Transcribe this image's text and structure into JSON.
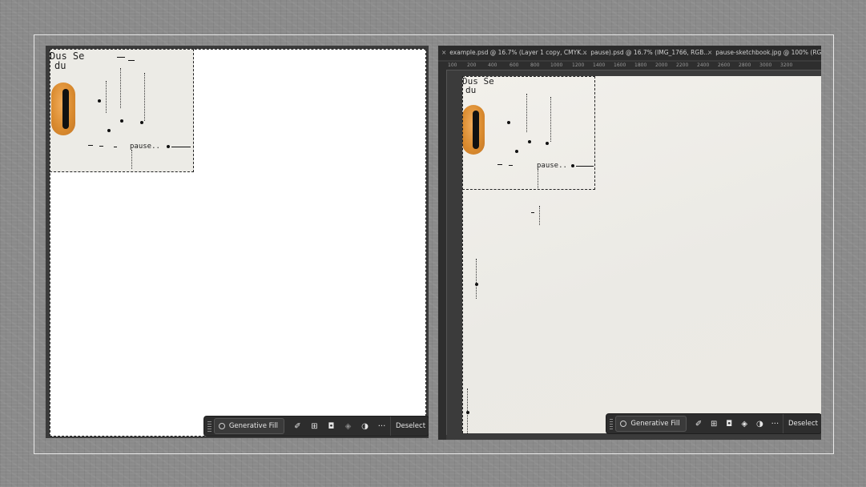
{
  "left_panel": {
    "art": {
      "handwriting_lines": [
        "Dus Se",
        "du"
      ],
      "label": "pause.."
    },
    "taskbar": {
      "generative_fill_label": "Generative Fill",
      "deselect_label": "Deselect",
      "more_label": "···"
    }
  },
  "right_panel": {
    "tabs": [
      {
        "label": "example.psd @ 16.7% (Layer 1 copy, CMYK..."
      },
      {
        "label": "pause).psd @ 16.7% (IMG_1766, RGB..."
      },
      {
        "label": "pause-sketchbook.jpg @ 100% (RGB..."
      }
    ],
    "ruler_ticks": [
      "100",
      "200",
      "400",
      "600",
      "800",
      "1000",
      "1200",
      "1400",
      "1600",
      "1800",
      "2000",
      "2200",
      "2400",
      "2600",
      "2800",
      "3000",
      "3200"
    ],
    "art": {
      "handwriting_lines": [
        "Dus Se",
        "du"
      ],
      "label": "pause.."
    },
    "taskbar": {
      "generative_fill_label": "Generative Fill",
      "deselect_label": "Deselect",
      "more_label": "···"
    }
  },
  "colors": {
    "background": "#8a8a8a",
    "panel": "#3b3b3b",
    "accent_orange": "#e0923a",
    "taskbar": "#2d2d2d"
  },
  "icons": [
    "close-icon",
    "sparkle-icon",
    "brush-icon",
    "expand-icon",
    "mask-icon",
    "fill-bucket-icon",
    "adjustment-icon",
    "more-icon"
  ]
}
